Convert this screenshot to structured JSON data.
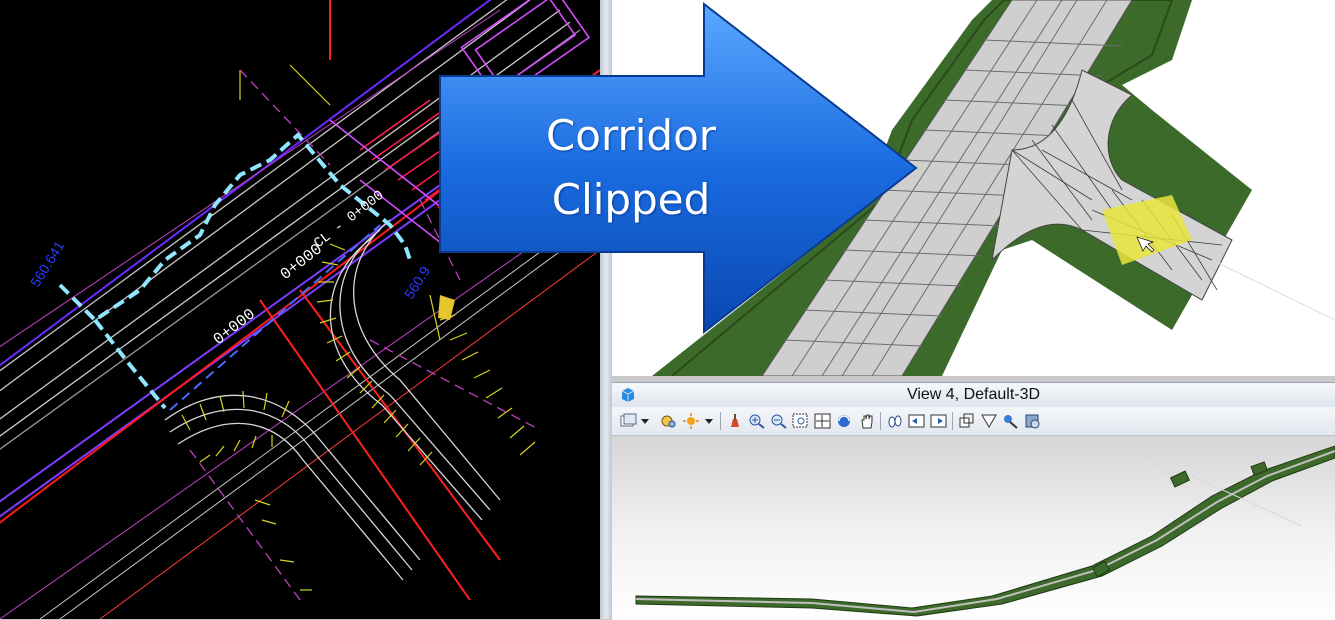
{
  "callout": {
    "line1": "Corridor",
    "line2": "Clipped"
  },
  "plan_view": {
    "station_labels": [
      "0+000",
      "0+000",
      "CL - 0+000"
    ],
    "offset_labels": [
      "560.641",
      "560.9"
    ]
  },
  "view4": {
    "title": "View 4, Default-3D"
  },
  "toolbar": {
    "icons": [
      "view-attributes-icon",
      "dropdown-arrow-icon",
      "display-style-icon",
      "lighting-icon",
      "dropdown-arrow-icon",
      "update-view-icon",
      "zoom-in-icon",
      "zoom-out-icon",
      "window-area-icon",
      "fit-view-icon",
      "rotate-view-icon",
      "pan-view-icon",
      "walk-icon",
      "previous-view-icon",
      "next-view-icon",
      "clip-volume-icon",
      "clip-mask-icon",
      "camera-icon",
      "render-icon"
    ]
  },
  "colors": {
    "callout_blue": "#1a6be0",
    "cad_background": "#000000",
    "terrain_green": "#3c6a2a",
    "highlight_yellow": "#e8e53a"
  }
}
